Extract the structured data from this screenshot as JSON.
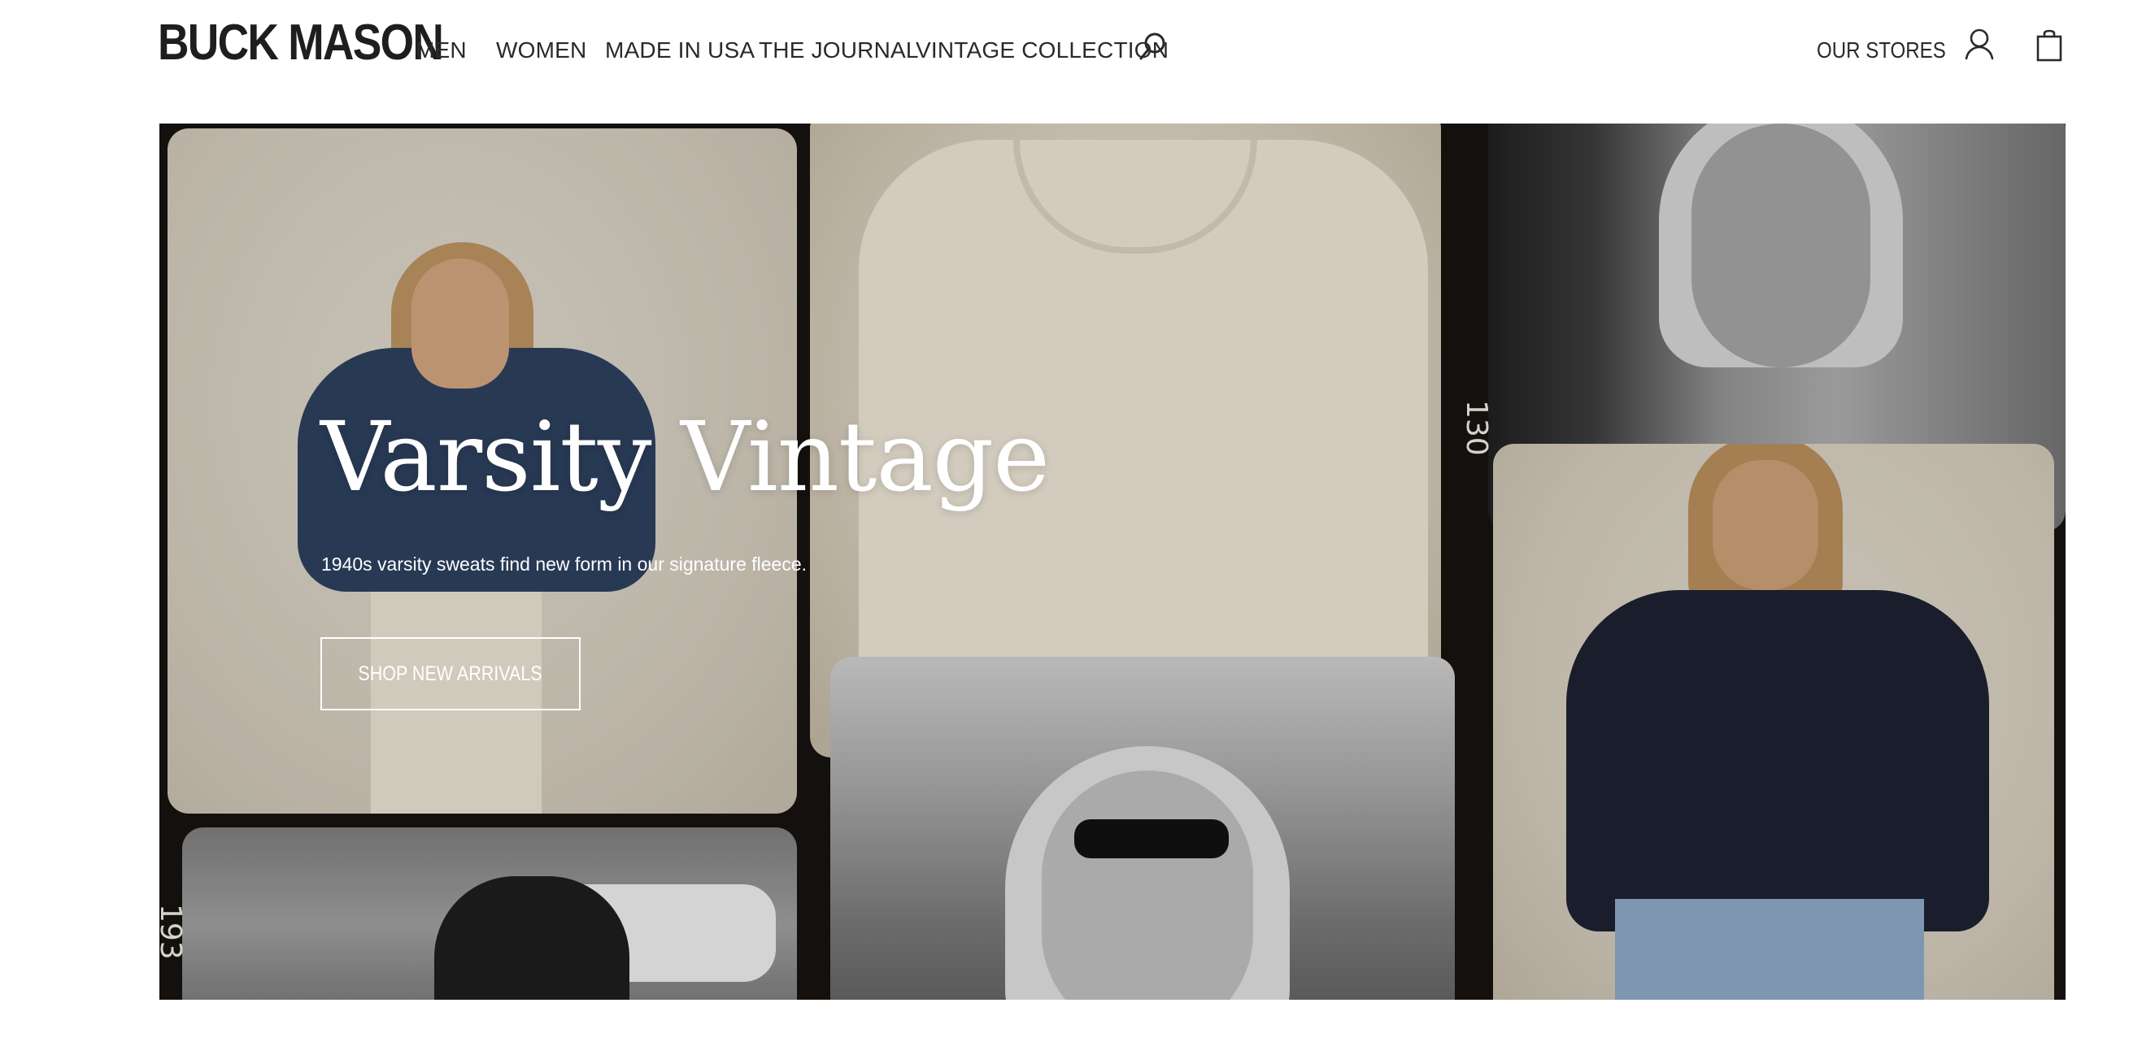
{
  "header": {
    "logo": "BUCK MASON",
    "nav": [
      {
        "label": "MEN"
      },
      {
        "label": "WOMEN"
      },
      {
        "label": "MADE IN USA"
      },
      {
        "label": "THE JOURNAL"
      },
      {
        "label": "VINTAGE COLLECTION"
      }
    ],
    "stores_label": "OUR STORES",
    "icons": {
      "search": "search-icon",
      "account": "account-icon",
      "bag": "shopping-bag-icon"
    }
  },
  "hero": {
    "title": "Varsity Vintage",
    "subtitle": "1940s varsity sweats find new form in our signature fleece.",
    "cta_label": "SHOP NEW ARRIVALS",
    "frame_numbers": [
      "130",
      "193"
    ]
  },
  "colors": {
    "text": "#2a2a2a",
    "hero_background": "#16120f",
    "hero_text": "#ffffff"
  }
}
